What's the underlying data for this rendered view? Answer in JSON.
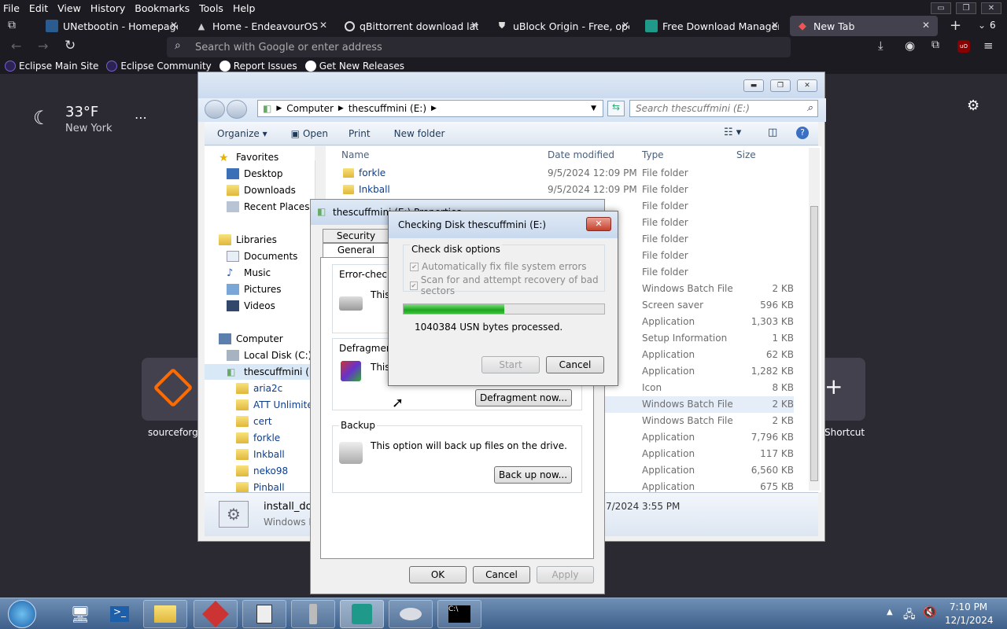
{
  "browser": {
    "menu": [
      "File",
      "Edit",
      "View",
      "History",
      "Bookmarks",
      "Tools",
      "Help"
    ],
    "tabs": [
      {
        "title": "UNetbootin - Homepage",
        "icon": "unetbootin-icon"
      },
      {
        "title": "Home - EndeavourOS",
        "icon": "endeavouros-icon"
      },
      {
        "title": "qBittorrent download late",
        "icon": "qbittorrent-icon"
      },
      {
        "title": "uBlock Origin - Free, ope",
        "icon": "ublock-icon"
      },
      {
        "title": "Free Download Manager",
        "icon": "fdm-icon"
      },
      {
        "title": "New Tab",
        "icon": "firefox-icon"
      }
    ],
    "tab_count": "6",
    "url_placeholder": "Search with Google or enter address",
    "bookmarks": [
      {
        "label": "Eclipse Main Site",
        "color": "#2c2255"
      },
      {
        "label": "Eclipse Community",
        "color": "#2c2255"
      },
      {
        "label": "Report Issues",
        "color": "#fff"
      },
      {
        "label": "Get New Releases",
        "color": "#fff"
      }
    ],
    "weather": {
      "temp": "33°F",
      "city": "New York"
    },
    "shortcuts": {
      "first": "sourceforge",
      "last": "Shortcut"
    },
    "accent": "#ff6b00"
  },
  "explorer": {
    "path": [
      "Computer",
      "thescuffmini (E:)"
    ],
    "search_placeholder": "Search thescuffmini (E:)",
    "commands": [
      "Organize ▾",
      "Open",
      "Print",
      "New folder"
    ],
    "nav": {
      "favorites": "Favorites",
      "fav_items": [
        "Desktop",
        "Downloads",
        "Recent Places"
      ],
      "libraries": "Libraries",
      "lib_items": [
        "Documents",
        "Music",
        "Pictures",
        "Videos"
      ],
      "computer": "Computer",
      "drives": [
        "Local Disk (C:)",
        "thescuffmini (E:)"
      ],
      "folders": [
        "aria2c",
        "ATT Unlimited",
        "cert",
        "forkle",
        "Inkball",
        "neko98",
        "Pinball"
      ]
    },
    "columns": [
      "Name",
      "Date modified",
      "Type",
      "Size"
    ],
    "rows": [
      {
        "name": "forkle",
        "date": "9/5/2024 12:09 PM",
        "type": "File folder",
        "size": ""
      },
      {
        "name": "Inkball",
        "date": "9/5/2024 12:09 PM",
        "type": "File folder",
        "size": ""
      },
      {
        "name": "",
        "date": "M",
        "type": "File folder",
        "size": ""
      },
      {
        "name": "",
        "date": "M",
        "type": "File folder",
        "size": ""
      },
      {
        "name": "",
        "date": "M",
        "type": "File folder",
        "size": ""
      },
      {
        "name": "",
        "date": "M",
        "type": "File folder",
        "size": ""
      },
      {
        "name": "",
        "date": "M",
        "type": "File folder",
        "size": ""
      },
      {
        "name": "",
        "date": "M",
        "type": "Windows Batch File",
        "size": "2 KB"
      },
      {
        "name": "",
        "date": "M",
        "type": "Screen saver",
        "size": "596 KB"
      },
      {
        "name": "",
        "date": "M",
        "type": "Application",
        "size": "1,303 KB"
      },
      {
        "name": "",
        "date": "AM",
        "type": "Setup Information",
        "size": "1 KB"
      },
      {
        "name": "",
        "date": "M",
        "type": "Application",
        "size": "62 KB"
      },
      {
        "name": "",
        "date": "M",
        "type": "Application",
        "size": "1,282 KB"
      },
      {
        "name": "",
        "date": "M",
        "type": "Icon",
        "size": "8 KB"
      },
      {
        "name": "",
        "date": "56 PM",
        "type": "Windows Batch File",
        "size": "2 KB"
      },
      {
        "name": "",
        "date": "15 PM",
        "type": "Windows Batch File",
        "size": "2 KB"
      },
      {
        "name": "",
        "date": "15 PM",
        "type": "Application",
        "size": "7,796 KB"
      },
      {
        "name": "",
        "date": "M",
        "type": "Application",
        "size": "117 KB"
      },
      {
        "name": "",
        "date": "M",
        "type": "Application",
        "size": "6,560 KB"
      },
      {
        "name": "",
        "date": "22 PM",
        "type": "Application",
        "size": "675 KB"
      }
    ],
    "status": {
      "name": "install_dot",
      "type": "Windows B",
      "date": "7/2024 3:55 PM"
    }
  },
  "props": {
    "title": "thescuffmini (E:) Properties",
    "tabs": [
      "Security",
      "General"
    ],
    "error_title": "Error-checkin",
    "error_text": "This",
    "defrag_title": "Defragmentat",
    "defrag_text": "This",
    "defrag_btn": "Defragment now...",
    "backup_title": "Backup",
    "backup_text": "This option will back up files on the drive.",
    "backup_btn": "Back up now...",
    "ok": "OK",
    "cancel": "Cancel",
    "apply": "Apply"
  },
  "chkdsk": {
    "title": "Checking Disk thescuffmini (E:)",
    "group": "Check disk options",
    "opt1": "Automatically fix file system errors",
    "opt2": "Scan for and attempt recovery of bad sectors",
    "progress": 0.5,
    "status": "1040384 USN bytes processed.",
    "start": "Start",
    "cancel": "Cancel"
  },
  "taskbar": {
    "time": "7:10 PM",
    "date": "12/1/2024"
  }
}
